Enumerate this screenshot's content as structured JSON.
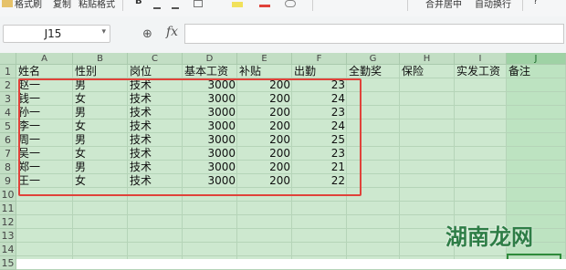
{
  "toolbar": {
    "items": [
      "格式刷",
      "复制",
      "粘贴格式",
      "B",
      "合并居中",
      "自动换行",
      "?"
    ]
  },
  "formula_bar": {
    "name_box": "J15",
    "fx_label": "fx",
    "formula_value": ""
  },
  "sheet": {
    "columns": [
      "A",
      "B",
      "C",
      "D",
      "E",
      "F",
      "G",
      "H",
      "I",
      "J"
    ],
    "selected_column": "J",
    "row_numbers": [
      "1",
      "2",
      "3",
      "4",
      "5",
      "6",
      "7",
      "8",
      "9",
      "10",
      "11",
      "12",
      "13",
      "14",
      "15"
    ],
    "header_row": [
      "姓名",
      "性别",
      "岗位",
      "基本工资",
      "补贴",
      "出勤",
      "全勤奖",
      "保险",
      "实发工资",
      "备注"
    ],
    "rows": [
      [
        "赵一",
        "男",
        "技术",
        "3000",
        "200",
        "23"
      ],
      [
        "钱一",
        "女",
        "技术",
        "3000",
        "200",
        "24"
      ],
      [
        "孙一",
        "男",
        "技术",
        "3000",
        "200",
        "23"
      ],
      [
        "李一",
        "女",
        "技术",
        "3000",
        "200",
        "24"
      ],
      [
        "周一",
        "男",
        "技术",
        "3000",
        "200",
        "25"
      ],
      [
        "吴一",
        "女",
        "技术",
        "3000",
        "200",
        "23"
      ],
      [
        "郑一",
        "男",
        "技术",
        "3000",
        "200",
        "21"
      ],
      [
        "王一",
        "女",
        "技术",
        "3000",
        "200",
        "22"
      ]
    ],
    "selected_cell": "J15"
  },
  "watermark": "湖南龙网",
  "colors": {
    "grid_background": "#cde8cf",
    "highlight_box": "#e0423a",
    "watermark": "#2e7d46"
  }
}
